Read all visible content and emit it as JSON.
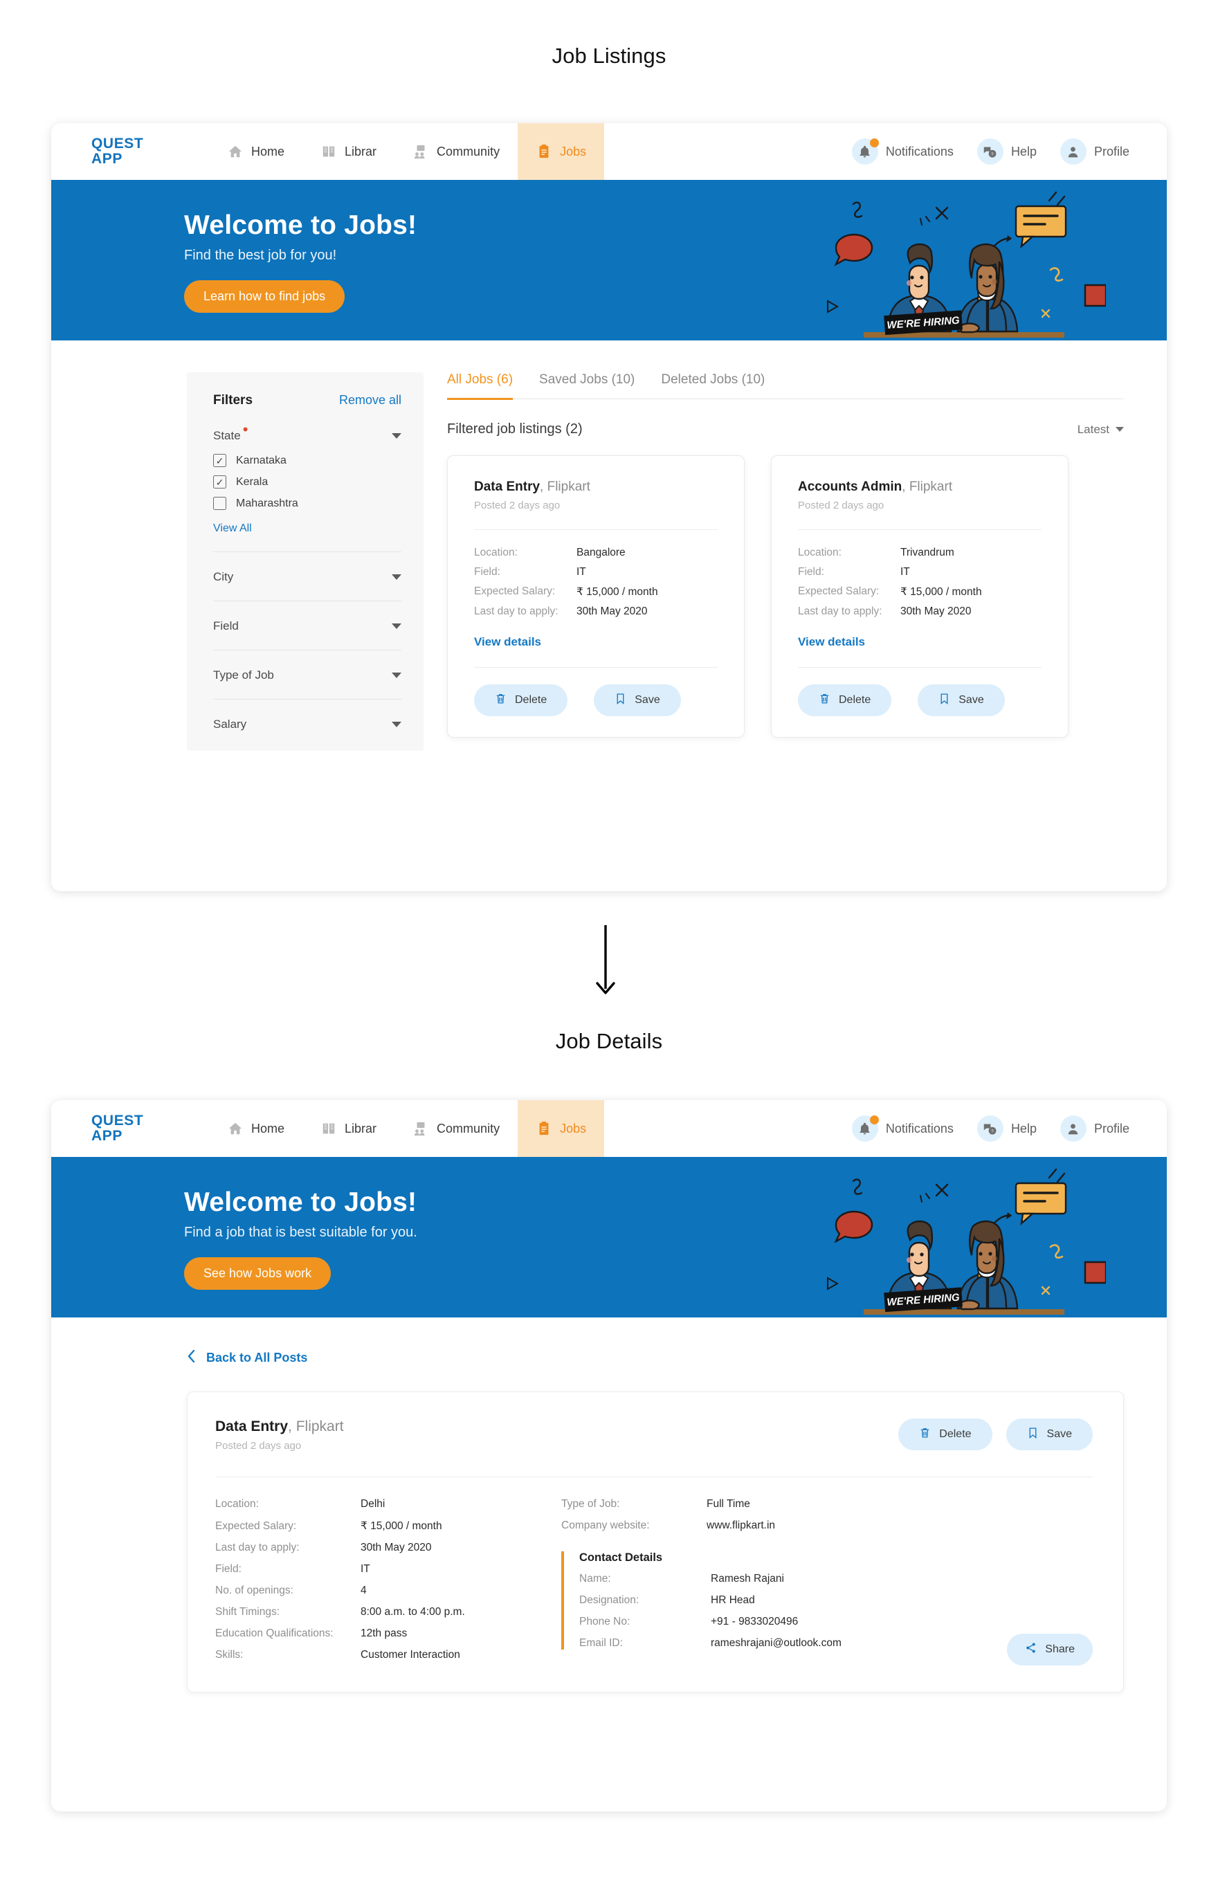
{
  "sections": {
    "listings_title": "Job Listings",
    "details_title": "Job Details"
  },
  "brand": {
    "line1": "QUEST",
    "line2": "APP",
    "color": "#1273bd"
  },
  "nav": {
    "items": [
      {
        "label": "Home",
        "icon": "home-icon"
      },
      {
        "label": "Librar",
        "icon": "book-icon"
      },
      {
        "label": "Community",
        "icon": "community-icon"
      },
      {
        "label": "Jobs",
        "icon": "clipboard-icon",
        "active": true
      }
    ],
    "right": [
      {
        "label": "Notifications",
        "icon": "bell-icon",
        "badge": true
      },
      {
        "label": "Help",
        "icon": "chat-question-icon"
      },
      {
        "label": "Profile",
        "icon": "user-icon"
      }
    ],
    "active_color": "#ef8b1f",
    "active_bg": "#fbe4c4"
  },
  "banner_listings": {
    "heading": "Welcome to Jobs!",
    "subtext": "Find the best job for you!",
    "button": "Learn how to find jobs",
    "bg": "#0d73bb",
    "button_bg": "#f0941f",
    "art_caption": "WE'RE HIRING"
  },
  "banner_details": {
    "heading": "Welcome to Jobs!",
    "subtext": "Find a job that is best suitable for you.",
    "button": "See how Jobs work",
    "bg": "#0d73bb",
    "button_bg": "#f0941f",
    "art_caption": "WE'RE HIRING"
  },
  "filters": {
    "title": "Filters",
    "remove_all": "Remove all",
    "state": {
      "label": "State",
      "required": true,
      "options": [
        {
          "label": "Karnataka",
          "checked": true
        },
        {
          "label": "Kerala",
          "checked": true
        },
        {
          "label": "Maharashtra",
          "checked": false
        }
      ],
      "view_all": "View All"
    },
    "collapsed": [
      {
        "label": "City"
      },
      {
        "label": "Field"
      },
      {
        "label": "Type of Job"
      },
      {
        "label": "Salary"
      }
    ]
  },
  "tabs": [
    {
      "label": "All Jobs (6)",
      "active": true
    },
    {
      "label": "Saved Jobs (10)",
      "active": false
    },
    {
      "label": "Deleted Jobs (10)",
      "active": false
    }
  ],
  "list_header": {
    "count_label": "Filtered job listings (2)",
    "sort_label": "Latest"
  },
  "cards": [
    {
      "title": "Data Entry",
      "company": "Flipkart",
      "posted": "Posted 2 days ago",
      "fields": [
        {
          "k": "Location:",
          "v": "Bangalore"
        },
        {
          "k": "Field:",
          "v": "IT"
        },
        {
          "k": "Expected Salary:",
          "v": "₹ 15,000 / month"
        },
        {
          "k": "Last day to apply:",
          "v": "30th May 2020"
        }
      ],
      "view_details": "View details",
      "delete_label": "Delete",
      "save_label": "Save"
    },
    {
      "title": "Accounts Admin",
      "company": "Flipkart",
      "posted": "Posted 2 days ago",
      "fields": [
        {
          "k": "Location:",
          "v": "Trivandrum"
        },
        {
          "k": "Field:",
          "v": "IT"
        },
        {
          "k": "Expected Salary:",
          "v": "₹ 15,000 / month"
        },
        {
          "k": "Last day to apply:",
          "v": "30th May 2020"
        }
      ],
      "view_details": "View details",
      "delete_label": "Delete",
      "save_label": "Save"
    }
  ],
  "details": {
    "back_label": "Back to All Posts",
    "title": "Data Entry",
    "company": "Flipkart",
    "posted": "Posted 2 days ago",
    "delete_label": "Delete",
    "save_label": "Save",
    "share_label": "Share",
    "left_fields": [
      {
        "k": "Location:",
        "v": "Delhi"
      },
      {
        "k": "Expected Salary:",
        "v": "₹ 15,000 / month"
      },
      {
        "k": "Last day to apply:",
        "v": "30th May 2020"
      },
      {
        "k": "Field:",
        "v": "IT"
      },
      {
        "k": "No. of openings:",
        "v": "4"
      },
      {
        "k": "Shift Timings:",
        "v": "8:00 a.m. to 4:00 p.m."
      },
      {
        "k": "Education Qualifications:",
        "v": "12th pass"
      },
      {
        "k": "Skills:",
        "v": "Customer Interaction"
      }
    ],
    "right_fields": [
      {
        "k": "Type of Job:",
        "v": "Full Time"
      },
      {
        "k": "Company website:",
        "v": "www.flipkart.in",
        "link": true
      }
    ],
    "contact": {
      "title": "Contact Details",
      "fields": [
        {
          "k": "Name:",
          "v": "Ramesh Rajani"
        },
        {
          "k": "Designation:",
          "v": "HR Head"
        },
        {
          "k": "Phone No:",
          "v": "+91 - 9833020496"
        },
        {
          "k": "Email ID:",
          "v": "rameshrajani@outlook.com"
        }
      ],
      "accent": "#f0941f"
    }
  }
}
